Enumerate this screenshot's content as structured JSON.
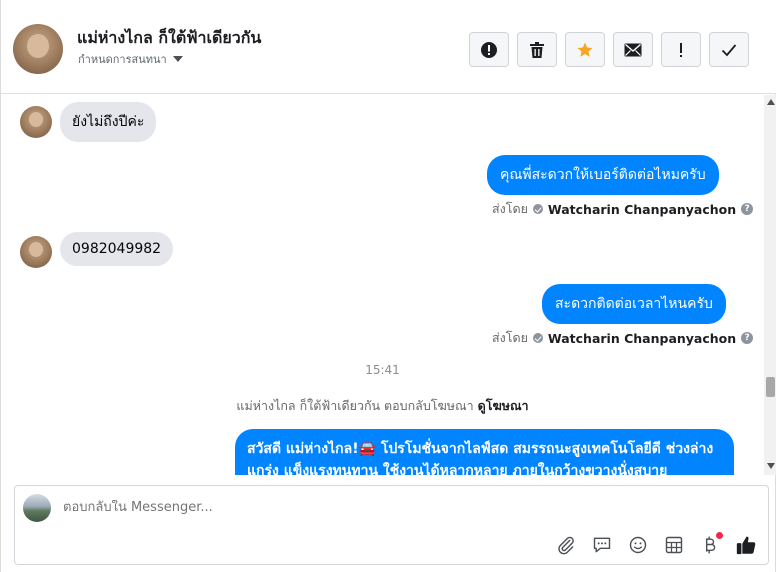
{
  "header": {
    "contact_name": "แม่ห่างไกล ก็ใต้ฟ้าเดียวกัน",
    "assign_label": "กำหนดการสนทนา",
    "actions": [
      {
        "icon": "alert-circle-icon"
      },
      {
        "icon": "trash-icon"
      },
      {
        "icon": "star-icon"
      },
      {
        "icon": "envelope-icon"
      },
      {
        "icon": "exclamation-icon"
      },
      {
        "icon": "check-icon"
      }
    ],
    "star_color": "#f5a623"
  },
  "messages": {
    "m1_text": "ยังไม่ถึงปีค่ะ",
    "m2_text": "คุณพี่สะดวกให้เบอร์ติดต่อไหมครับ",
    "m3_text": "0982049982",
    "m4_text": "สะดวกติดต่อเวลาไหนครับ",
    "sent_by_label": "ส่งโดย",
    "sent_by_name": "Watcharin Chanpanyachon",
    "timestamp": "15:41",
    "ad_reply_text": "แม่ห่างไกล ก็ใต้ฟ้าเดียวกัน ตอบกลับโฆษณา",
    "ad_reply_link": "ดูโฆษณา",
    "m5_text": "สวัสดี แม่ห่างไกล!🚘 โปรโมชั่นจากไลฟ์สด สมรรถนะสูงเทคโนโลยีดี ช่วงล่างแกร่ง แข็งแรงทนทาน ใช้งานได้หลากหลาย ภายในกว้างขวางนั่งสบาย"
  },
  "composer": {
    "placeholder": "ตอบกลับใน Messenger..."
  },
  "colors": {
    "outgoing_bubble": "#0084ff",
    "incoming_bubble": "#e4e6eb",
    "like_icon": "#1c1e21",
    "notification_dot": "#f02849"
  }
}
